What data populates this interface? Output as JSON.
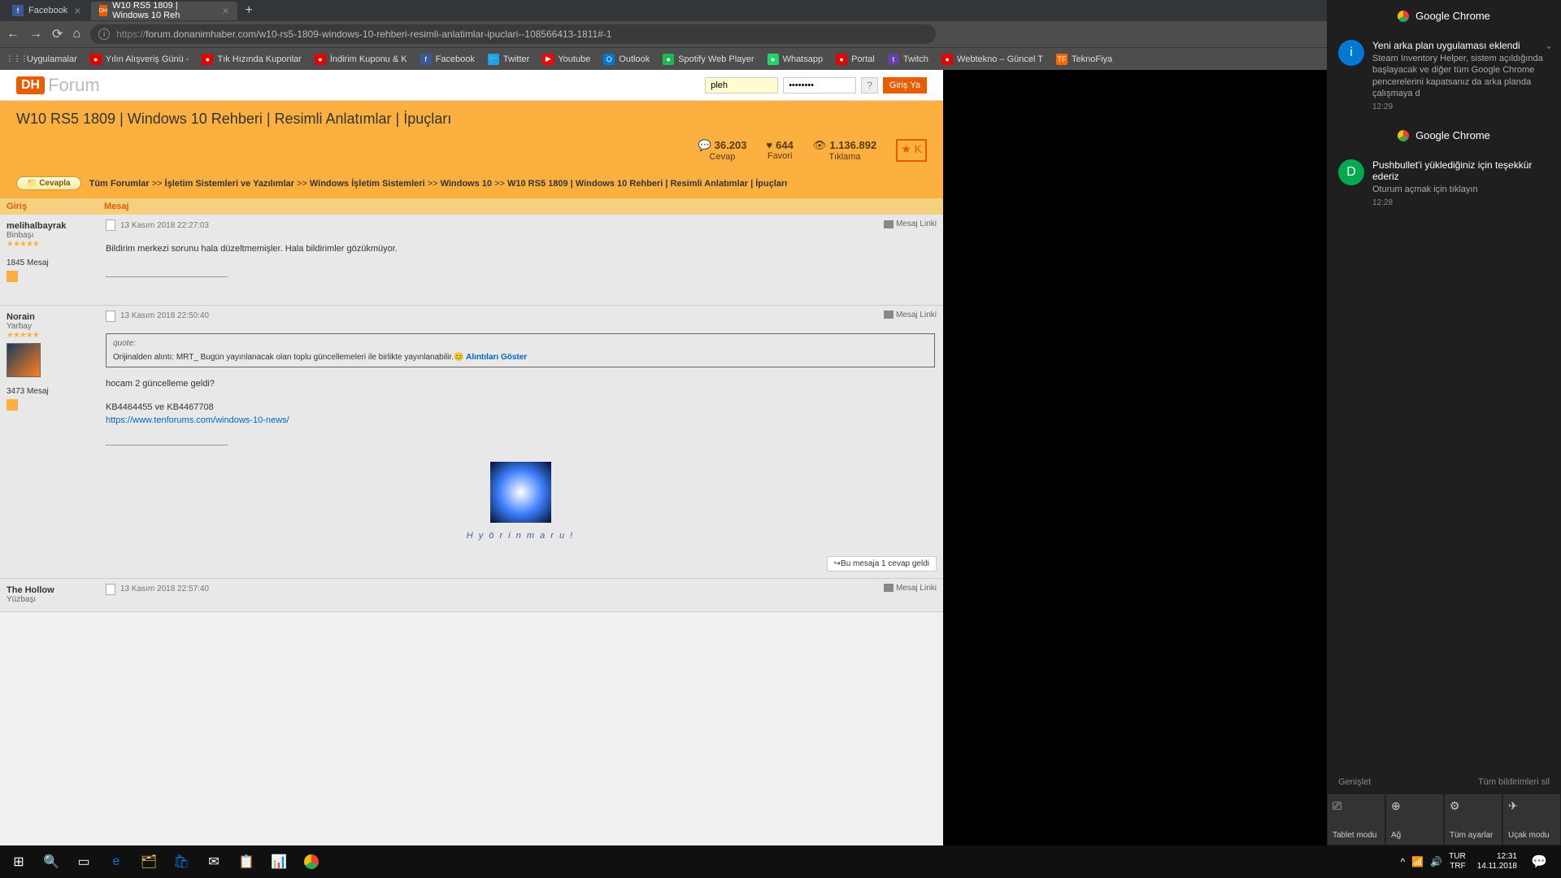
{
  "browser": {
    "tabs": [
      {
        "favicon_bg": "#3b5998",
        "favicon_text": "f",
        "title": "Facebook"
      },
      {
        "favicon_bg": "#e85d00",
        "favicon_text": "DH",
        "title": "W10 RS5 1809 | Windows 10 Reh"
      }
    ],
    "url_prefix": "https://",
    "url_rest": "forum.donanimhaber.com/w10-rs5-1809-windows-10-rehberi-resimli-anlatimlar-ipuclari--108566413-1811#-1",
    "bookmarks": [
      {
        "icon": "⋮⋮⋮",
        "bg": "",
        "label": "Uygulamalar"
      },
      {
        "icon": "●",
        "bg": "#e60000",
        "label": "Yılın Alışveriş Günü -"
      },
      {
        "icon": "●",
        "bg": "#e60000",
        "label": "Tık Hızında Kuponlar"
      },
      {
        "icon": "●",
        "bg": "#e60000",
        "label": "İndirim Kuponu & K"
      },
      {
        "icon": "f",
        "bg": "#3b5998",
        "label": "Facebook"
      },
      {
        "icon": "🐦",
        "bg": "#1da1f2",
        "label": "Twitter"
      },
      {
        "icon": "▶",
        "bg": "#ff0000",
        "label": "Youtube"
      },
      {
        "icon": "O",
        "bg": "#0078d4",
        "label": "Outlook"
      },
      {
        "icon": "●",
        "bg": "#1db954",
        "label": "Spotify Web Player"
      },
      {
        "icon": "●",
        "bg": "#25d366",
        "label": "Whatsapp"
      },
      {
        "icon": "●",
        "bg": "#e60000",
        "label": "Portal"
      },
      {
        "icon": "t",
        "bg": "#6441a5",
        "label": "Twitch"
      },
      {
        "icon": "●",
        "bg": "#e60000",
        "label": "Webtekno – Güncel T"
      },
      {
        "icon": "TF",
        "bg": "#ff6600",
        "label": "TeknoFiya"
      }
    ]
  },
  "site": {
    "logo1": "DH",
    "logo2": "Forum",
    "user_value": "pleh",
    "pass_value": "••••••••",
    "help": "?",
    "login": "Giriş Ya"
  },
  "page_title": "W10 RS5 1809 | Windows 10 Rehberi | Resimli Anlatımlar | İpuçları",
  "stats": {
    "replies_val": "36.203",
    "replies_lbl": "Cevap",
    "fav_val": "644",
    "fav_lbl": "Favori",
    "views_val": "1.136.892",
    "views_lbl": "Tıklama",
    "star_lbl": "K"
  },
  "reply_btn": "Cevapla",
  "breadcrumb_parts": [
    "Tüm Forumlar",
    "İşletim Sistemleri ve Yazılımlar",
    "Windows İşletim Sistemleri",
    "Windows 10",
    "W10 RS5 1809 | Windows 10 Rehberi | Resimli Anlatımlar | İpuçları"
  ],
  "bc_sep": " >> ",
  "th_user": "Giriş",
  "th_msg": "Mesaj",
  "msg_link_label": "Mesaj Linki",
  "posts": [
    {
      "user": "melihalbayrak",
      "rank": "Binbaşı",
      "stars": "★★★★★",
      "msgs": "1845 Mesaj",
      "ts": "13 Kasım 2018 22:27:03",
      "text": "Bildirim merkezi sorunu hala düzeltmemişler. Hala bildirimler gözükmüyor."
    },
    {
      "user": "Norain",
      "rank": "Yarbay",
      "stars": "★★★★★",
      "msgs": "3473 Mesaj",
      "ts": "13 Kasım 2018 22:50:40",
      "quote_label": "quote:",
      "quote_text": "Orijinalden alıntı: MRT_ Bugün yayınlanacak olan toplu güncellemeleri ile birlikte yayınlanabilir.",
      "quote_link": "Alıntıları Göster",
      "text1": "hocam 2 güncelleme geldi?",
      "text2": "KB4464455 ve KB4467708",
      "link": "https://www.tenforums.com/windows-10-news/",
      "reply_badge": "Bu mesaja 1 cevap geldi",
      "sig": "H y ö r i n m a r u !"
    },
    {
      "user": "The Hollow",
      "rank": "Yüzbaşı",
      "ts": "13 Kasım 2018 22:57:40"
    }
  ],
  "action_center": {
    "section": "Google Chrome",
    "notifs": [
      {
        "icon": "i",
        "color": "blue",
        "title": "Yeni arka plan uygulaması eklendi",
        "desc": "Steam Inventory Helper, sistem açıldığında başlayacak ve diğer tüm Google Chrome pencerelerini kapatsanız da arka planda çalışmaya d",
        "time": "12:29"
      },
      {
        "icon": "D",
        "color": "green",
        "title": "Pushbullet'i yüklediğiniz için teşekkür ederiz",
        "desc": "Oturum açmak için tıklayın",
        "time": "12:28"
      }
    ],
    "expand": "Genişlet",
    "clear": "Tüm bildirimleri sil",
    "tiles": [
      {
        "icon": "⎚",
        "label": "Tablet modu"
      },
      {
        "icon": "⊕",
        "label": "Ağ"
      },
      {
        "icon": "⚙",
        "label": "Tüm ayarlar"
      },
      {
        "icon": "✈",
        "label": "Uçak modu"
      }
    ]
  },
  "taskbar": {
    "locale1": "TUR",
    "locale2": "TRF",
    "time": "12:31",
    "date": "14.11.2018"
  }
}
